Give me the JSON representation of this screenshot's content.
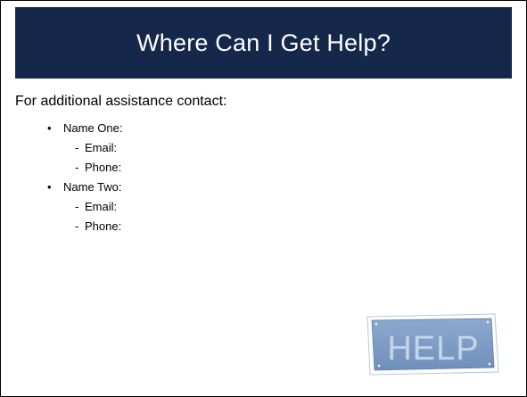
{
  "slide": {
    "title": "Where Can I Get Help?",
    "intro": "For additional assistance contact:",
    "contacts": [
      {
        "name": "Name One:",
        "details": [
          "Email:",
          "Phone:"
        ]
      },
      {
        "name": "Name Two:",
        "details": [
          "Email:",
          "Phone:"
        ]
      }
    ],
    "help_sign_text": "HELP"
  },
  "colors": {
    "title_bar": "#15284b",
    "sign_face": "#7e9cc4",
    "sign_text": "#c5d6ea"
  }
}
